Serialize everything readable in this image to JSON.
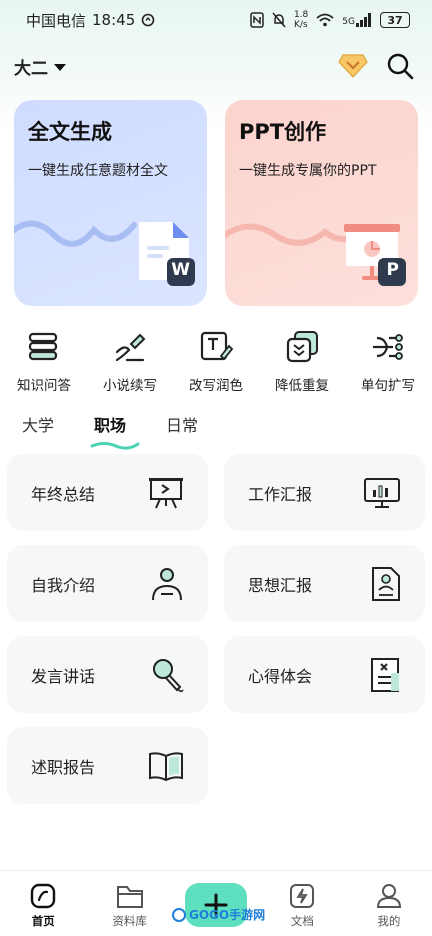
{
  "status_bar": {
    "carrier": "中国电信",
    "time": "18:45",
    "speed_top": "1.8",
    "speed_unit": "K/s",
    "network": "5G",
    "battery": "37"
  },
  "header": {
    "grade": "大二"
  },
  "feature_cards": [
    {
      "title": "全文生成",
      "subtitle": "一键生成任意题材全文",
      "badge": "W"
    },
    {
      "title": "PPT创作",
      "subtitle": "一键生成专属你的PPT",
      "badge": "P"
    }
  ],
  "tools": [
    {
      "label": "知识问答",
      "icon": "books-icon"
    },
    {
      "label": "小说续写",
      "icon": "pen-icon"
    },
    {
      "label": "改写润色",
      "icon": "edit-text-icon"
    },
    {
      "label": "降低重复",
      "icon": "dedupe-icon"
    },
    {
      "label": "单句扩写",
      "icon": "expand-icon"
    }
  ],
  "tabs": [
    {
      "label": "大学",
      "active": false
    },
    {
      "label": "职场",
      "active": true
    },
    {
      "label": "日常",
      "active": false
    }
  ],
  "templates": [
    {
      "label": "年终总结",
      "icon": "presentation-icon"
    },
    {
      "label": "工作汇报",
      "icon": "monitor-chart-icon"
    },
    {
      "label": "自我介绍",
      "icon": "person-icon"
    },
    {
      "label": "思想汇报",
      "icon": "document-person-icon"
    },
    {
      "label": "发言讲话",
      "icon": "microphone-icon"
    },
    {
      "label": "心得体会",
      "icon": "notes-icon"
    },
    {
      "label": "述职报告",
      "icon": "book-icon"
    }
  ],
  "bottom_nav": [
    {
      "label": "首页",
      "active": true
    },
    {
      "label": "资料库",
      "active": false
    },
    {
      "label": "",
      "active": false
    },
    {
      "label": "文档",
      "active": false
    },
    {
      "label": "我的",
      "active": false
    }
  ],
  "watermark": "GOGO手游网",
  "colors": {
    "accent": "#5ee0c0",
    "blue_card": "#d6e1ff",
    "pink_card": "#fcd8d2",
    "word_badge": "#2f3a4f",
    "ppt_badge": "#2f3a4f"
  }
}
